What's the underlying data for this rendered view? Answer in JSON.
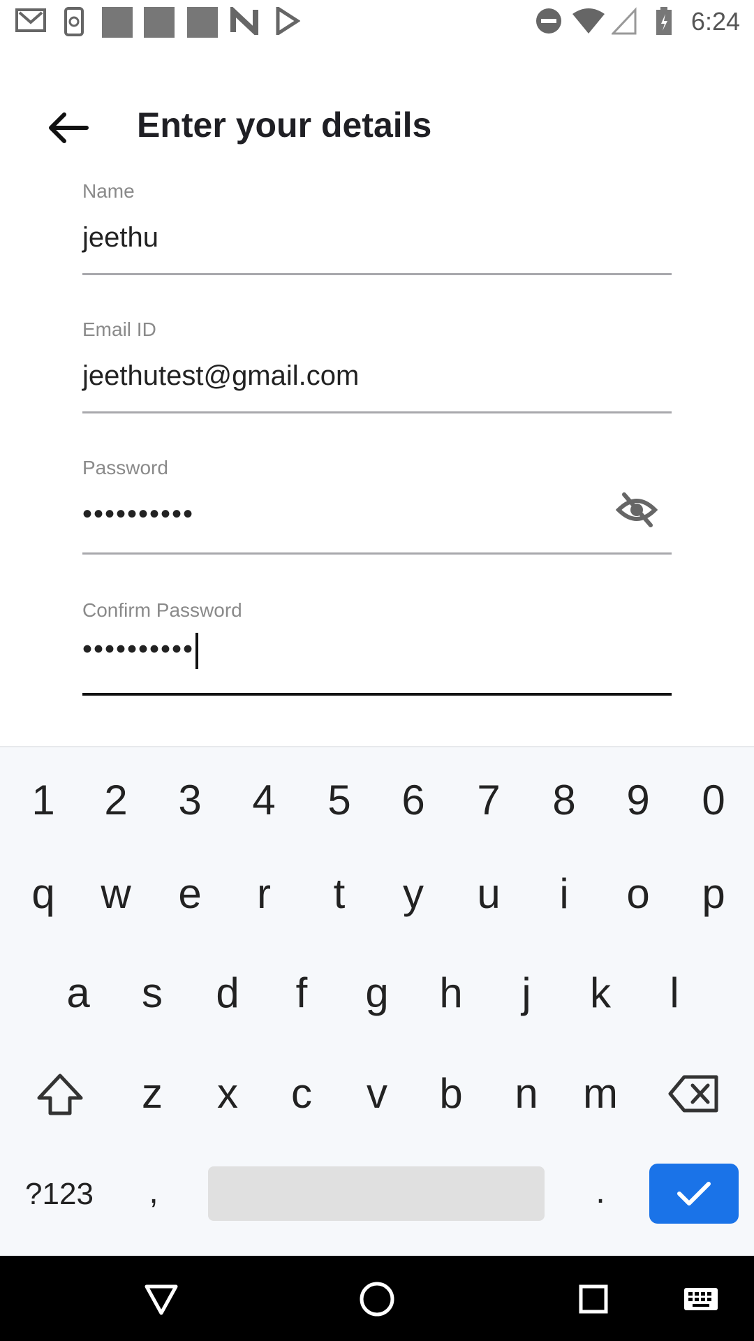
{
  "status_bar": {
    "time": "6:24",
    "icons": [
      "gmail-icon",
      "phone-sync-icon",
      "app-icon",
      "app-icon",
      "app-icon",
      "n-icon",
      "play-store-icon",
      "do-not-disturb-icon",
      "wifi-icon",
      "signal-icon",
      "battery-icon"
    ]
  },
  "header": {
    "title": "Enter your details"
  },
  "form": {
    "name": {
      "label": "Name",
      "value": "jeethu"
    },
    "email": {
      "label": "Email ID",
      "value": "jeethutest@gmail.com"
    },
    "password": {
      "label": "Password",
      "value": "••••••••••"
    },
    "confirm_password": {
      "label": "Confirm Password",
      "value": "••••••••••"
    }
  },
  "keyboard": {
    "row_numbers": [
      "1",
      "2",
      "3",
      "4",
      "5",
      "6",
      "7",
      "8",
      "9",
      "0"
    ],
    "row_top": [
      "q",
      "w",
      "e",
      "r",
      "t",
      "y",
      "u",
      "i",
      "o",
      "p"
    ],
    "row_middle": [
      "a",
      "s",
      "d",
      "f",
      "g",
      "h",
      "j",
      "k",
      "l"
    ],
    "row_bottom": [
      "z",
      "x",
      "c",
      "v",
      "b",
      "n",
      "m"
    ],
    "symbols_key": "?123",
    "comma_key": ",",
    "period_key": "."
  },
  "colors": {
    "accent": "#1a73e8",
    "keyboard_bg": "#f6f8fb",
    "underline": "#a8a8ac"
  }
}
